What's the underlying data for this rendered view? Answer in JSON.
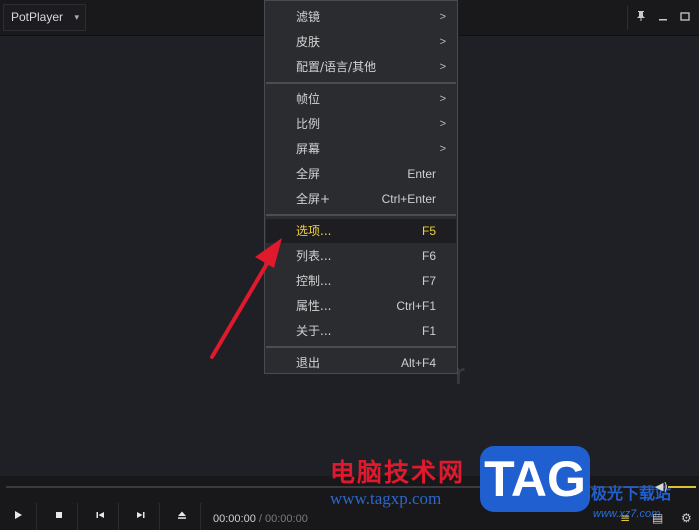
{
  "app": {
    "title": "PotPlayer"
  },
  "menu": {
    "items": [
      {
        "label": "滤镜",
        "shortcut": "",
        "submenu": ">"
      },
      {
        "label": "皮肤",
        "shortcut": "",
        "submenu": ">"
      },
      {
        "label": "配置/语言/其他",
        "shortcut": "",
        "submenu": ">"
      },
      {
        "label": "帧位",
        "shortcut": "",
        "submenu": ">"
      },
      {
        "label": "比例",
        "shortcut": "",
        "submenu": ">"
      },
      {
        "label": "屏幕",
        "shortcut": "",
        "submenu": ">"
      },
      {
        "label": "全屏",
        "shortcut": "Enter",
        "submenu": ""
      },
      {
        "label": "全屏+",
        "shortcut": "Ctrl+Enter",
        "submenu": ""
      },
      {
        "label": "选项...",
        "shortcut": "F5",
        "submenu": ""
      },
      {
        "label": "列表...",
        "shortcut": "F6",
        "submenu": ""
      },
      {
        "label": "控制...",
        "shortcut": "F7",
        "submenu": ""
      },
      {
        "label": "属性...",
        "shortcut": "Ctrl+F1",
        "submenu": ""
      },
      {
        "label": "关于...",
        "shortcut": "F1",
        "submenu": ""
      },
      {
        "label": "退出",
        "shortcut": "Alt+F4",
        "submenu": ""
      }
    ],
    "highlighted_index": 8
  },
  "video": {
    "ghost_text": "r"
  },
  "playback": {
    "current_time": "00:00:00",
    "separator": "/",
    "duration": "00:00:00"
  },
  "watermark": {
    "cn_text": "电脑技术网",
    "url": "www.tagxp.com",
    "badge": "TAG",
    "right_text": "极光下载站",
    "right_url": "www.xz7.com"
  },
  "colors": {
    "menu_bg": "#2b2c30",
    "highlight_text": "#f0d23a",
    "arrow": "#e0192c",
    "watermark_red": "#e0192c",
    "watermark_blue": "#1f5fd0"
  }
}
